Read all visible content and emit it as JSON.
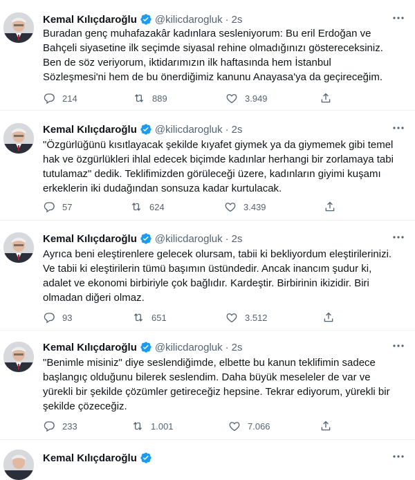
{
  "tweets": [
    {
      "name": "Kemal Kılıçdaroğlu",
      "handle": "@kilicdarogluk",
      "dot": "·",
      "time": "2s",
      "lines": [
        "Buradan genç muhafazakâr kadınlara sesleniyorum: Bu eril Erdoğan ve",
        "Bahçeli siyasetine ilk seçimde siyasal rehine olmadığınızı göstereceksiniz.",
        "Ben de söz veriyorum, iktidarımızın ilk haftasında hem İstanbul",
        "Sözleşmesi'ni hem de bu önerdiğimiz kanunu Anayasa'ya da geçireceğim."
      ],
      "replies": "214",
      "retweets": "889",
      "likes": "3.949"
    },
    {
      "name": "Kemal Kılıçdaroğlu",
      "handle": "@kilicdarogluk",
      "dot": "·",
      "time": "2s",
      "lines": [
        "\"Özgürlüğünü kısıtlayacak şekilde kıyafet giymek ya da giymemek gibi temel",
        "hak ve özgürlükleri ihlal edecek biçimde kadınlar herhangi bir zorlamaya tabi",
        "tutulamaz\" dedik. Teklifimizden görüleceği üzere, kadınların giyimi kuşamı",
        "erkeklerin iki dudağından sonsuza kadar kurtulacak."
      ],
      "replies": "57",
      "retweets": "624",
      "likes": "3.439"
    },
    {
      "name": "Kemal Kılıçdaroğlu",
      "handle": "@kilicdarogluk",
      "dot": "·",
      "time": "2s",
      "lines": [
        "Ayrıca beni eleştirenlere gelecek olursam, tabii ki bekliyordum eleştirilerinizi.",
        "Ve tabii ki eleştirilerin tümü başımın üstündedir. Ancak inancım şudur ki,",
        "adalet ve ekonomi birbiriyle çok bağlıdır. Kardeştir. Birbirinin ikizidir. Biri",
        "olmadan diğeri olmaz."
      ],
      "replies": "93",
      "retweets": "651",
      "likes": "3.512"
    },
    {
      "name": "Kemal Kılıçdaroğlu",
      "handle": "@kilicdarogluk",
      "dot": "·",
      "time": "2s",
      "lines": [
        "\"Benimle misiniz\" diye seslendiğimde, elbette bu kanun teklifimin sadece",
        "başlangıç olduğunu bilerek seslendim. Daha büyük meseleler de var ve",
        "yürekli bir şekilde çözümler getireceğiz hepsine. Tekrar ediyorum, yürekli bir",
        "şekilde çözeceğiz."
      ],
      "replies": "233",
      "retweets": "1.001",
      "likes": "7.066"
    },
    {
      "name": "Kemal Kılıçdaroğlu",
      "handle": "",
      "dot": "",
      "time": "",
      "lines": [],
      "replies": "",
      "retweets": "",
      "likes": ""
    }
  ],
  "colors": {
    "verified": "#1d9bf0",
    "text": "#0f1419",
    "muted": "#536471"
  },
  "icons": [
    "avatar",
    "verified-badge-icon",
    "more-icon",
    "reply-icon",
    "retweet-icon",
    "like-icon",
    "share-icon"
  ]
}
